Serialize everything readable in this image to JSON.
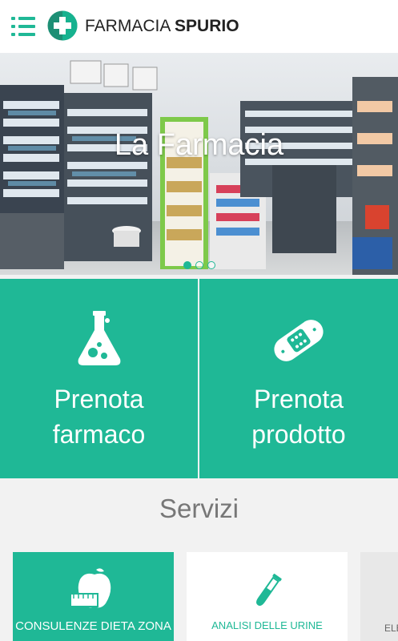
{
  "header": {
    "brand_light": "FARMACIA",
    "brand_bold": "SPURIO"
  },
  "hero": {
    "title": "La Farmacia",
    "slides": 3,
    "active_slide": 1
  },
  "tiles": [
    {
      "line1": "Prenota",
      "line2": "farmaco",
      "icon": "flask-icon"
    },
    {
      "line1": "Prenota",
      "line2": "prodotto",
      "icon": "bandage-icon"
    }
  ],
  "services": {
    "title": "Servizi",
    "cards": [
      {
        "label": "CONSULENZE DIETA ZONA",
        "icon": "apple-tape-icon"
      },
      {
        "label": "ANALISI DELLE URINE",
        "icon": "test-tube-icon"
      },
      {
        "label": "ELE",
        "icon": ""
      }
    ]
  },
  "colors": {
    "accent": "#1fb896",
    "header_bg": "#ffffff",
    "page_bg": "#f2f2f2"
  }
}
